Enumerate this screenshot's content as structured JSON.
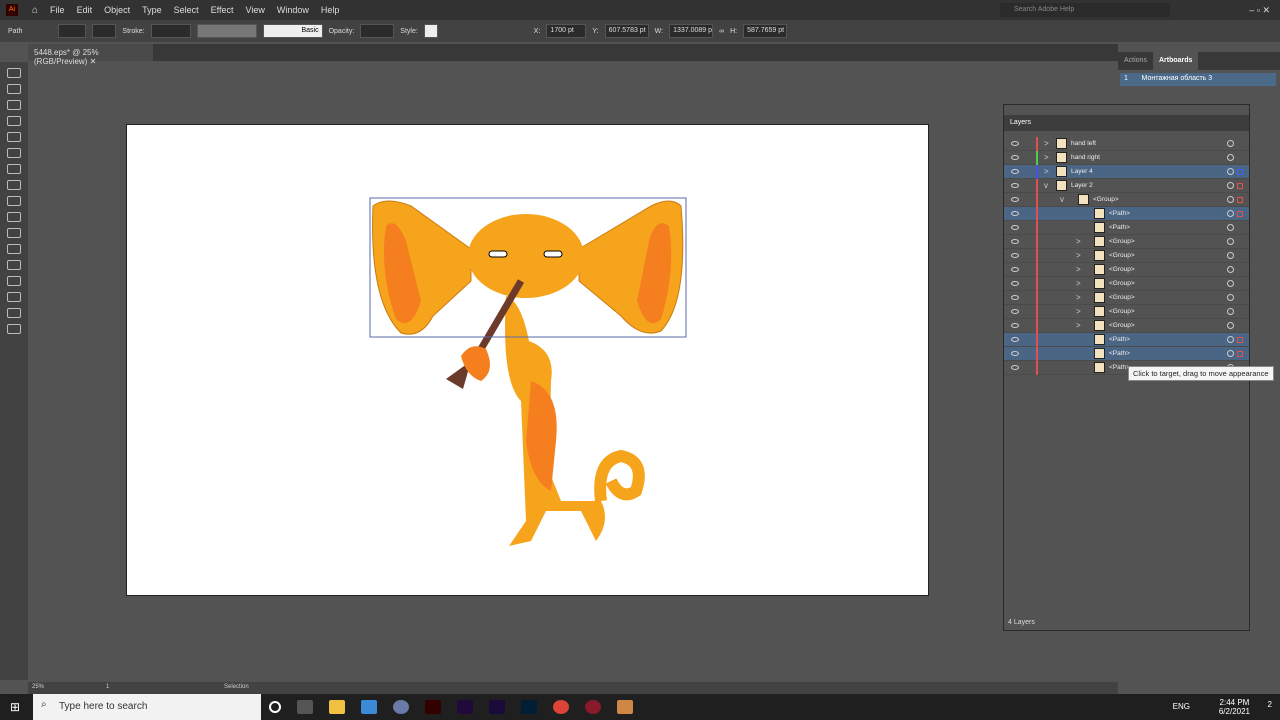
{
  "app": {
    "logo": "Ai",
    "menu": [
      "File",
      "Edit",
      "Object",
      "Type",
      "Select",
      "Effect",
      "View",
      "Window",
      "Help"
    ],
    "search_placeholder": "Search Adobe Help"
  },
  "control": {
    "selection_type": "Path",
    "stroke_label": "Stroke:",
    "brush": "Basic",
    "opacity_label": "Opacity:",
    "style_label": "Style:",
    "x_label": "X:",
    "x": "1700 pt",
    "y_label": "Y:",
    "y": "607.5783 pt",
    "w_label": "W:",
    "w": "1337.0089 p",
    "h_label": "H:",
    "h": "587.7659 pt"
  },
  "document": {
    "tab": "5448.eps* @ 25% (RGB/Preview)"
  },
  "panels": {
    "tabs": [
      "Actions",
      "Artboards"
    ],
    "artboard_num": "1",
    "artboard_name": "Монтажная область 3"
  },
  "layers": {
    "title": "Layers",
    "footer": "4 Layers",
    "tooltip": "Click to target, drag to move appearance",
    "rows": [
      {
        "name": "hand left",
        "indent": 0,
        "expand": ">",
        "color": "#e05050",
        "sel": false,
        "sq": ""
      },
      {
        "name": "hand right",
        "indent": 0,
        "expand": ">",
        "color": "#4cd04c",
        "sel": false,
        "sq": ""
      },
      {
        "name": "Layer 4",
        "indent": 0,
        "expand": ">",
        "color": "#5050e0",
        "sel": true,
        "sq": "#4060ff"
      },
      {
        "name": "Layer 2",
        "indent": 0,
        "expand": "v",
        "color": "#e05050",
        "sel": false,
        "sq": "#e05050"
      },
      {
        "name": "<Group>",
        "indent": 1,
        "expand": "v",
        "color": "#e05050",
        "sel": false,
        "sq": "#e05050"
      },
      {
        "name": "<Path>",
        "indent": 2,
        "expand": "",
        "color": "#e05050",
        "sel": true,
        "sq": "#e05050"
      },
      {
        "name": "<Path>",
        "indent": 2,
        "expand": "",
        "color": "#e05050",
        "sel": false,
        "sq": ""
      },
      {
        "name": "<Group>",
        "indent": 2,
        "expand": ">",
        "color": "#e05050",
        "sel": false,
        "sq": ""
      },
      {
        "name": "<Group>",
        "indent": 2,
        "expand": ">",
        "color": "#e05050",
        "sel": false,
        "sq": ""
      },
      {
        "name": "<Group>",
        "indent": 2,
        "expand": ">",
        "color": "#e05050",
        "sel": false,
        "sq": ""
      },
      {
        "name": "<Group>",
        "indent": 2,
        "expand": ">",
        "color": "#e05050",
        "sel": false,
        "sq": ""
      },
      {
        "name": "<Group>",
        "indent": 2,
        "expand": ">",
        "color": "#e05050",
        "sel": false,
        "sq": ""
      },
      {
        "name": "<Group>",
        "indent": 2,
        "expand": ">",
        "color": "#e05050",
        "sel": false,
        "sq": ""
      },
      {
        "name": "<Group>",
        "indent": 2,
        "expand": ">",
        "color": "#e05050",
        "sel": false,
        "sq": ""
      },
      {
        "name": "<Path>",
        "indent": 2,
        "expand": "",
        "color": "#e05050",
        "sel": true,
        "sq": "#e05050"
      },
      {
        "name": "<Path>",
        "indent": 2,
        "expand": "",
        "color": "#e05050",
        "sel": true,
        "sq": "#e05050"
      },
      {
        "name": "<Path>",
        "indent": 2,
        "expand": "",
        "color": "#e05050",
        "sel": false,
        "sq": ""
      }
    ]
  },
  "status": {
    "zoom": "25%",
    "artboard": "1",
    "tool": "Selection"
  },
  "taskbar": {
    "search": "Type here to search",
    "lang": "ENG",
    "time": "2:44 PM",
    "date": "6/2/2021",
    "notifications": "2"
  },
  "colors": {
    "body": "#f7a41d",
    "ear_inner": "#f57f1f",
    "instrument": "#6b3a2a",
    "selection": "#5a6aa8"
  }
}
